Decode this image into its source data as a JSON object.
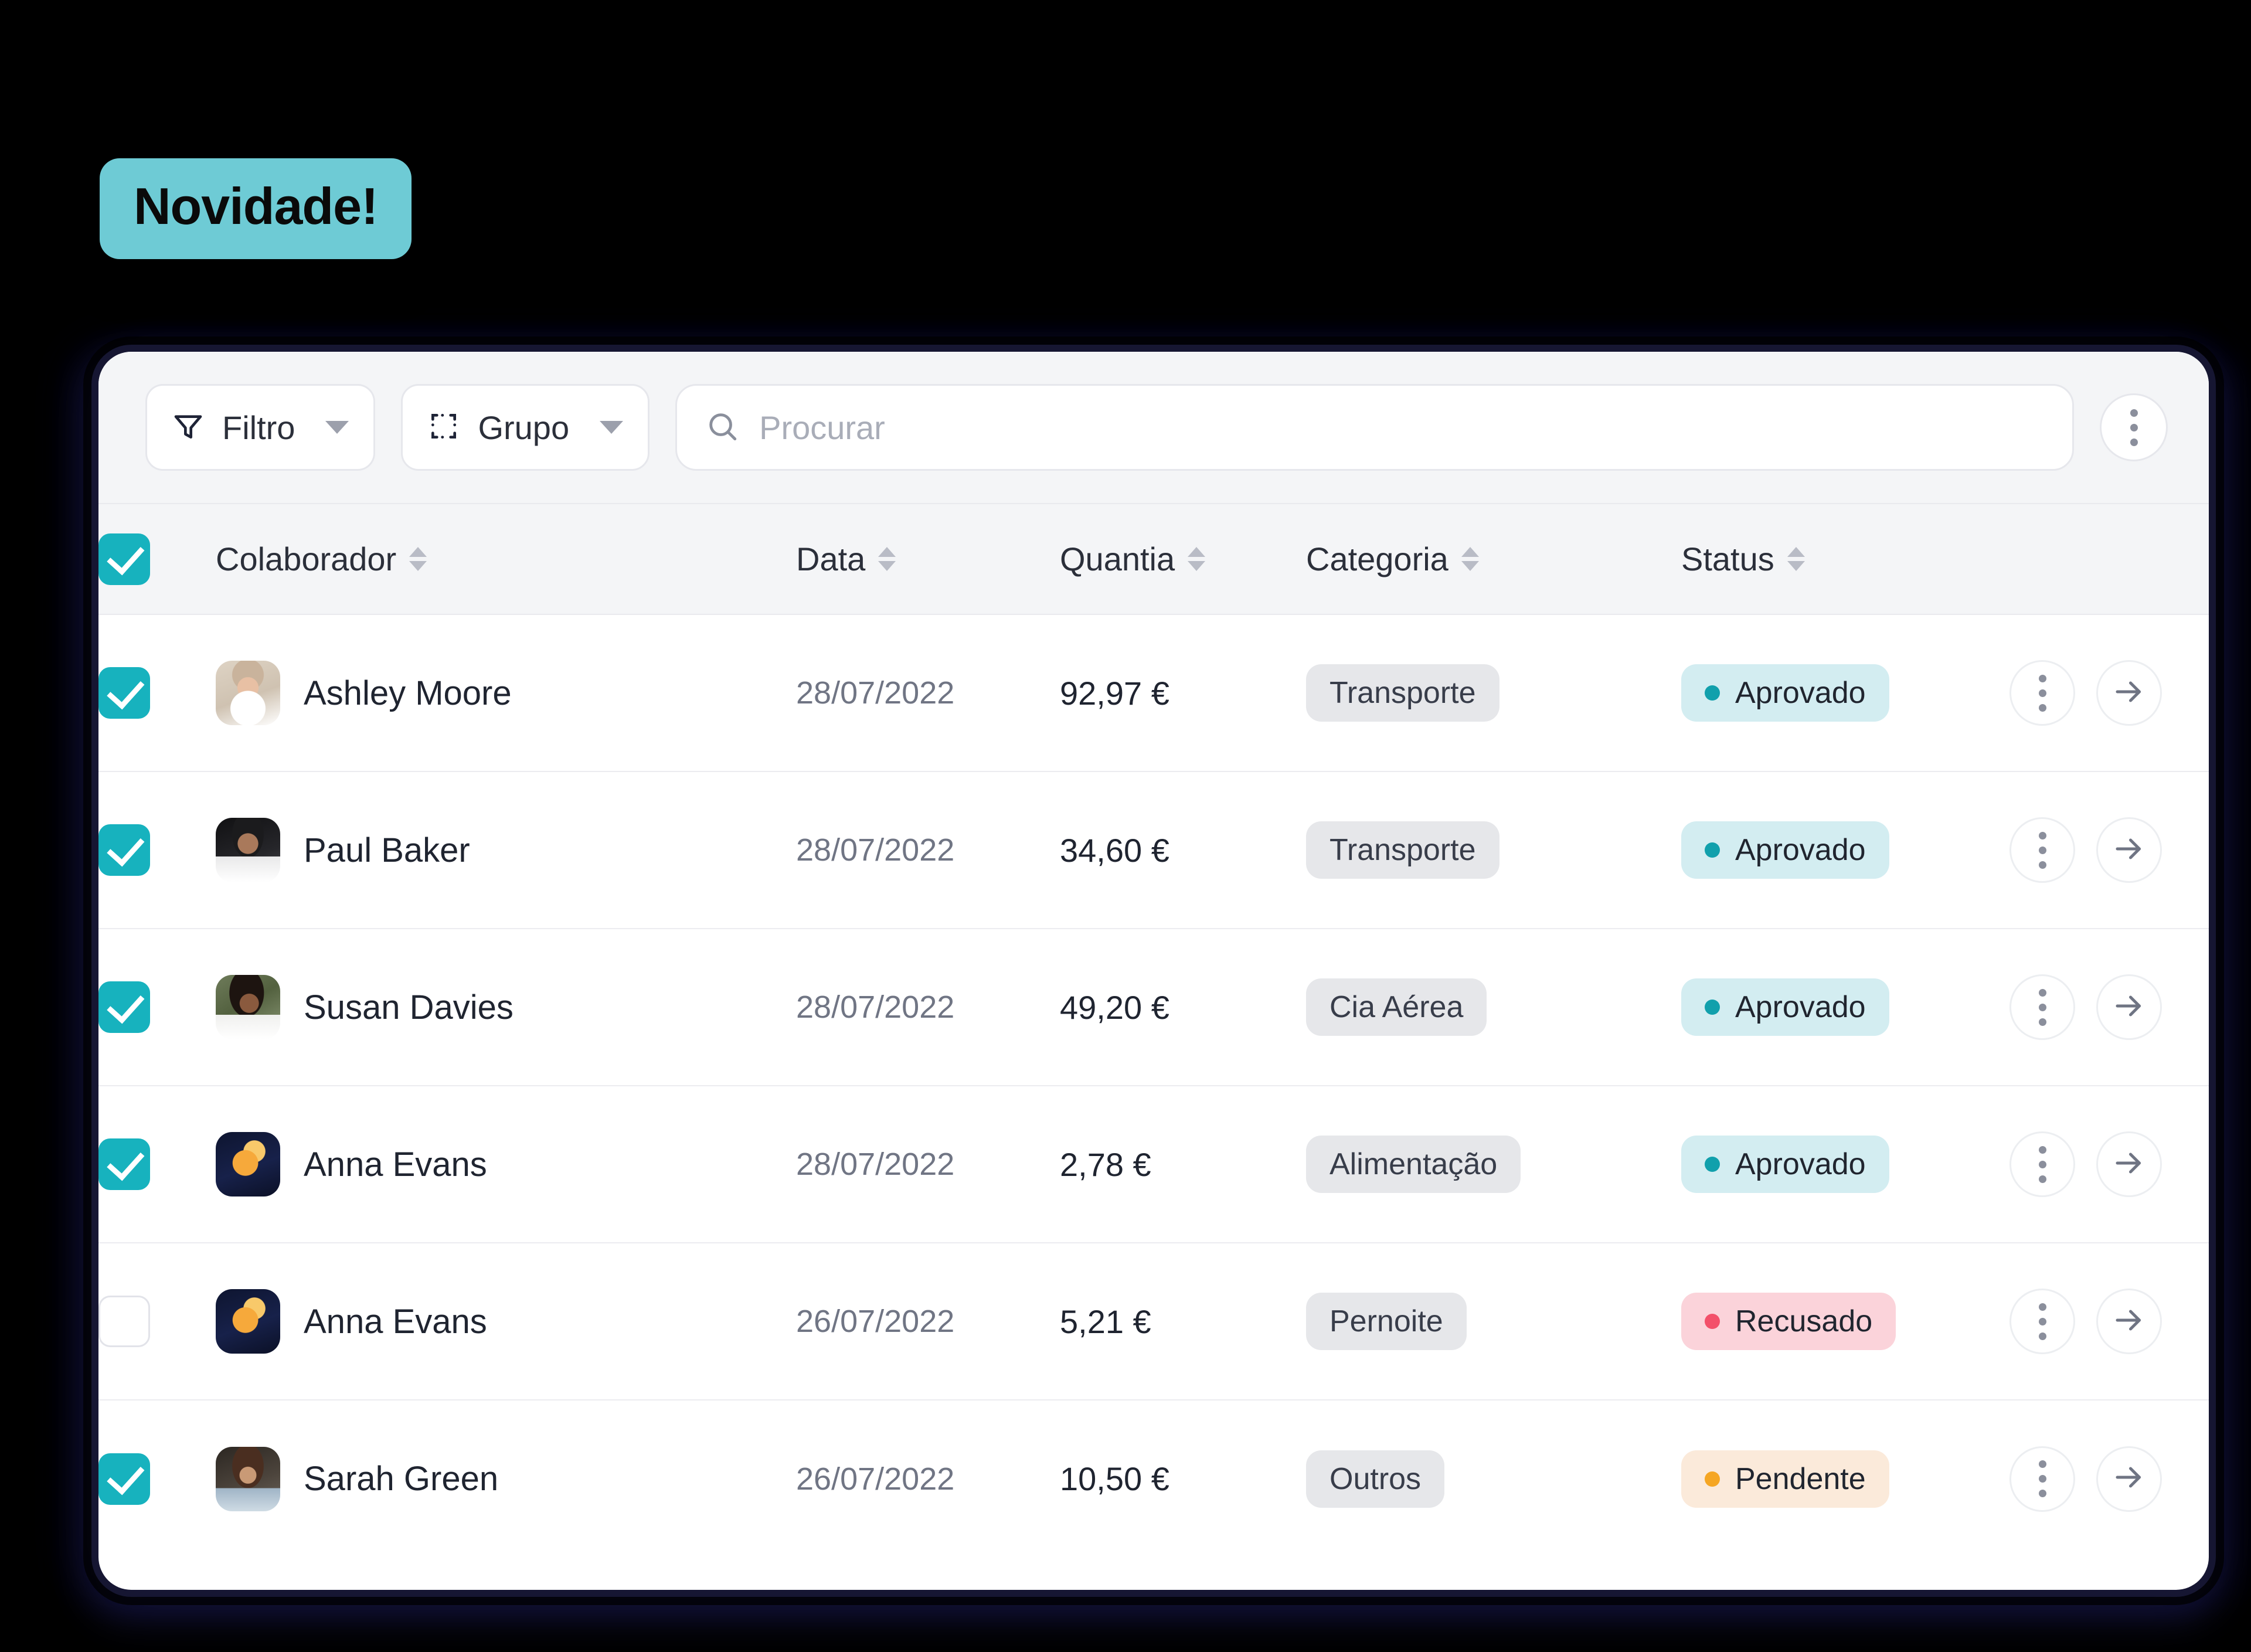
{
  "badge": {
    "label": "Novidade!",
    "color": "#6ECBD5"
  },
  "toolbar": {
    "filter_label": "Filtro",
    "group_label": "Grupo",
    "search_placeholder": "Procurar",
    "search_value": "",
    "more_menu_label": "",
    "icons": {
      "filter": "funnel-icon",
      "group": "group-select-icon",
      "search": "search-icon",
      "more": "kebab-menu-icon"
    }
  },
  "table": {
    "select_all_checked": true,
    "columns": [
      {
        "key": "collaborator",
        "label": "Colaborador",
        "sortable": true
      },
      {
        "key": "date",
        "label": "Data",
        "sortable": true
      },
      {
        "key": "amount",
        "label": "Quantia",
        "sortable": true
      },
      {
        "key": "category",
        "label": "Categoria",
        "sortable": true
      },
      {
        "key": "status",
        "label": "Status",
        "sortable": true
      }
    ],
    "rows": [
      {
        "checked": true,
        "name": "Ashley Moore",
        "avatar": "av-ashley",
        "date": "28/07/2022",
        "amount": "92,97 €",
        "category": "Transporte",
        "status": "Aprovado",
        "status_kind": "aprovado"
      },
      {
        "checked": true,
        "name": "Paul Baker",
        "avatar": "av-paul",
        "date": "28/07/2022",
        "amount": "34,60 €",
        "category": "Transporte",
        "status": "Aprovado",
        "status_kind": "aprovado"
      },
      {
        "checked": true,
        "name": "Susan Davies",
        "avatar": "av-susan",
        "date": "28/07/2022",
        "amount": "49,20 €",
        "category": "Cia Aérea",
        "status": "Aprovado",
        "status_kind": "aprovado"
      },
      {
        "checked": true,
        "name": "Anna Evans",
        "avatar": "av-anna",
        "date": "28/07/2022",
        "amount": "2,78 €",
        "category": "Alimentação",
        "status": "Aprovado",
        "status_kind": "aprovado"
      },
      {
        "checked": false,
        "name": "Anna Evans",
        "avatar": "av-anna",
        "date": "26/07/2022",
        "amount": "5,21 €",
        "category": "Pernoite",
        "status": "Recusado",
        "status_kind": "recusado"
      },
      {
        "checked": true,
        "name": "Sarah Green",
        "avatar": "av-sarah",
        "date": "26/07/2022",
        "amount": "10,50 €",
        "category": "Outros",
        "status": "Pendente",
        "status_kind": "pendente"
      }
    ],
    "row_actions": {
      "menu_icon": "kebab-menu-icon",
      "open_icon": "arrow-right-icon"
    }
  },
  "colors": {
    "accent_teal": "#17B2BE",
    "badge_teal": "#6ECBD5",
    "status_approved_bg": "#d3edf1",
    "status_approved_dot": "#11a0ac",
    "status_rejected_bg": "#fbd3da",
    "status_rejected_dot": "#f3506a",
    "status_pending_bg": "#fbeada",
    "status_pending_dot": "#f5a623",
    "category_pill_bg": "#e6e7ea",
    "toolbar_bg": "#f4f5f7",
    "page_bg": "#000000"
  }
}
